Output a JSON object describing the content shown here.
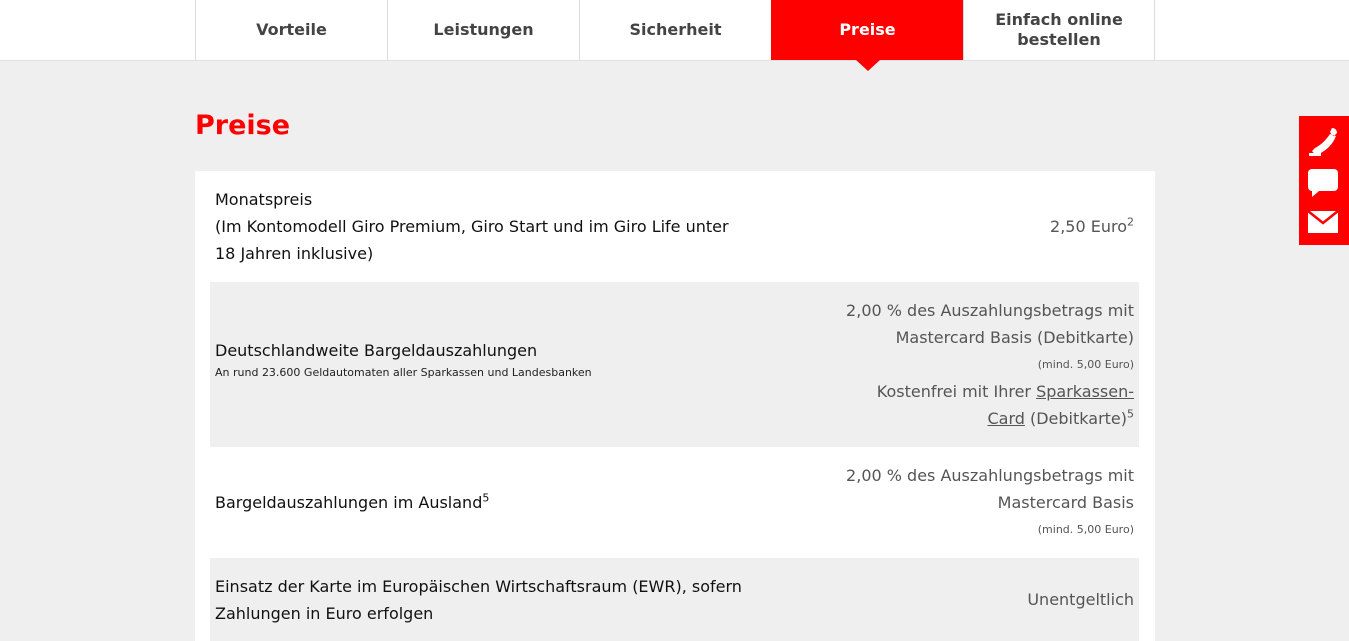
{
  "nav": {
    "tabs": [
      {
        "label": "Vorteile"
      },
      {
        "label": "Leistungen"
      },
      {
        "label": "Sicherheit"
      },
      {
        "label": "Preise"
      },
      {
        "label_line1": "Einfach online",
        "label_line2": "bestellen"
      }
    ],
    "active_tab": "Preise"
  },
  "page": {
    "title": "Preise"
  },
  "prices": {
    "row1": {
      "label_line1": "Monatspreis",
      "label_line2": "(Im Kontomodell Giro Premium, Giro Start und im Giro Life unter",
      "label_line3": "18 Jahren inklusive)",
      "value": "2,50 Euro",
      "value_sup": "2"
    },
    "row2": {
      "label": "Deutschlandweite Bargeldauszahlungen",
      "sub": "An rund 23.600 Geldautomaten aller Sparkassen und Landesbanken",
      "value_line1": "2,00 % des Auszahlungsbetrags mit",
      "value_line2": "Mastercard Basis (Debitkarte)",
      "value_min": "(mind. 5,00 Euro)",
      "value_line3_prefix": "Kostenfrei mit Ihrer ",
      "value_link_part1": "Sparkassen-",
      "value_link_part2": "Card",
      "value_line4_suffix": " (Debitkarte)",
      "value_sup": "5"
    },
    "row3": {
      "label": "Bargeldauszahlungen im Ausland",
      "label_sup": "5",
      "value_line1": "2,00 % des Auszahlungsbetrags mit",
      "value_line2": "Mastercard Basis",
      "value_min": "(mind. 5,00 Euro)"
    },
    "row4": {
      "label_line1": "Einsatz der Karte im Europäischen Wirtschaftsraum (EWR), sofern",
      "label_line2": "Zahlungen in Euro erfolgen",
      "value": "Unentgeltlich"
    }
  },
  "sidebar": {
    "icons": [
      "phone-icon",
      "chat-icon",
      "mail-icon"
    ]
  },
  "colors": {
    "accent": "#ff0000",
    "background": "#efefef",
    "card": "#ffffff"
  }
}
